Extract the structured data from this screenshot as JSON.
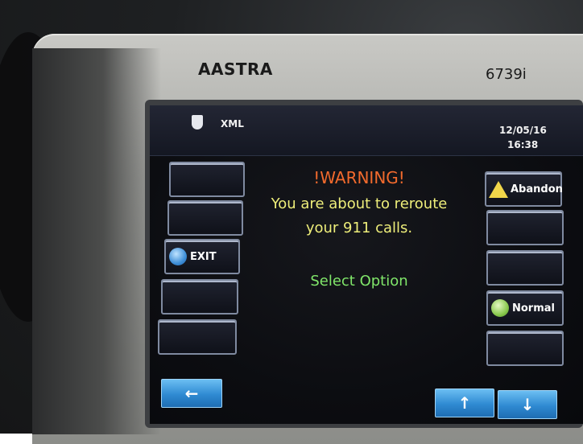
{
  "device": {
    "brand": "AASTRA",
    "model": "6739i"
  },
  "statusbar": {
    "app_label": "XML",
    "date": "12/05/16",
    "time": "16:38"
  },
  "message": {
    "title": "!WARNING!",
    "line1": "You are about to reroute",
    "line2": "your 911 calls.",
    "prompt": "Select Option"
  },
  "softkeys_left": [
    {
      "label": "",
      "icon": ""
    },
    {
      "label": "",
      "icon": ""
    },
    {
      "label": "EXIT",
      "icon": "exit-icon"
    },
    {
      "label": "",
      "icon": ""
    },
    {
      "label": "",
      "icon": ""
    }
  ],
  "softkeys_right": [
    {
      "label": "Abandon",
      "icon": "warning-icon"
    },
    {
      "label": "",
      "icon": ""
    },
    {
      "label": "",
      "icon": ""
    },
    {
      "label": "Normal",
      "icon": "normal-icon"
    },
    {
      "label": "",
      "icon": ""
    }
  ],
  "nav": {
    "left": "←",
    "up": "↑",
    "down": "↓"
  },
  "colors": {
    "warning": "#f26a2d",
    "message": "#eeee7a",
    "prompt": "#80e66a",
    "nav_button": "#2f8ad2"
  }
}
